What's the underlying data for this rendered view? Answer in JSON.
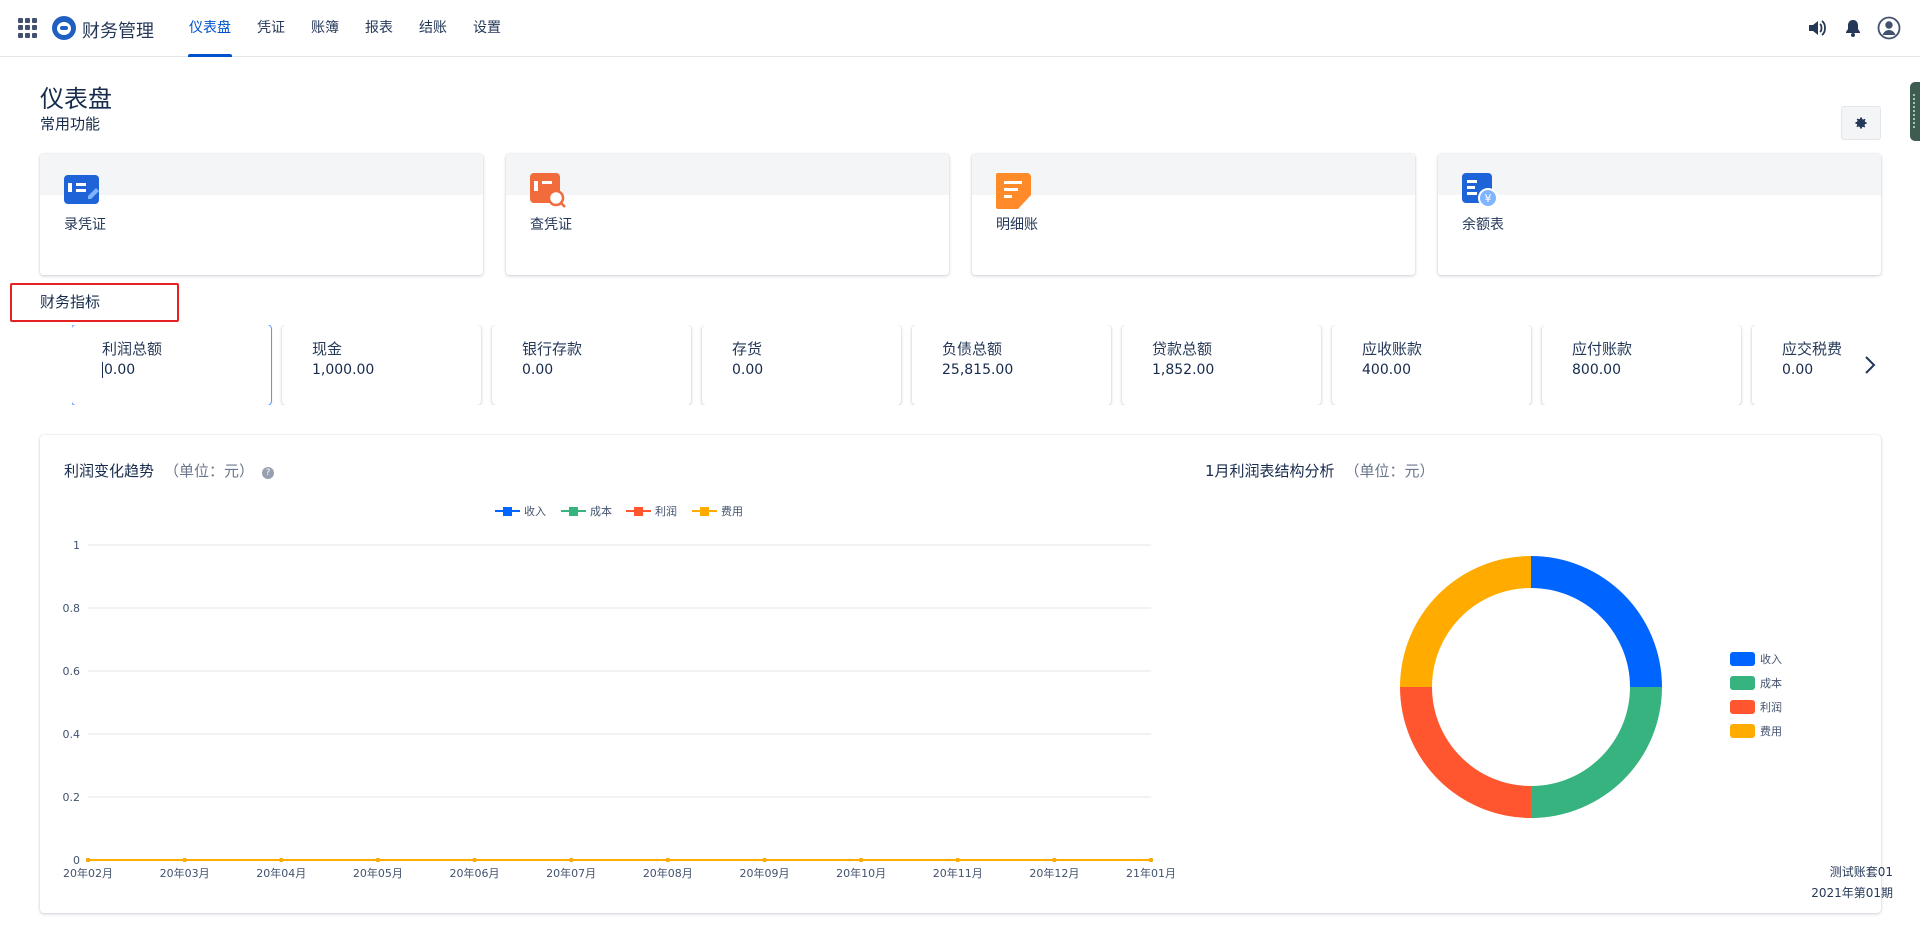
{
  "header": {
    "app_title": "财务管理",
    "nav": [
      {
        "label": "仪表盘",
        "active": true
      },
      {
        "label": "凭证",
        "active": false
      },
      {
        "label": "账簿",
        "active": false
      },
      {
        "label": "报表",
        "active": false
      },
      {
        "label": "结账",
        "active": false
      },
      {
        "label": "设置",
        "active": false
      }
    ],
    "icons": [
      "apps-grid-icon",
      "app-logo",
      "volume-icon",
      "bell-icon",
      "user-avatar-icon"
    ]
  },
  "page": {
    "title": "仪表盘",
    "common_functions_label": "常用功能",
    "financial_indicators_label": "财务指标"
  },
  "quick_links": [
    {
      "label": "录凭证",
      "icon": "record-voucher-icon",
      "color": "#1f63d8"
    },
    {
      "label": "查凭证",
      "icon": "search-voucher-icon",
      "color": "#f26b3a"
    },
    {
      "label": "明细账",
      "icon": "ledger-detail-icon",
      "color": "#ff8a2a"
    },
    {
      "label": "余额表",
      "icon": "balance-sheet-icon",
      "color": "#1f63d8"
    }
  ],
  "metrics": [
    {
      "label": "利润总额",
      "value": "0.00",
      "selected": true
    },
    {
      "label": "现金",
      "value": "1,000.00"
    },
    {
      "label": "银行存款",
      "value": "0.00"
    },
    {
      "label": "存货",
      "value": "0.00"
    },
    {
      "label": "负债总额",
      "value": "25,815.00"
    },
    {
      "label": "贷款总额",
      "value": "1,852.00"
    },
    {
      "label": "应收账款",
      "value": "400.00"
    },
    {
      "label": "应付账款",
      "value": "800.00"
    },
    {
      "label": "应交税费",
      "value": "0.00"
    }
  ],
  "charts": {
    "trend": {
      "title": "利润变化趋势",
      "unit": "（单位：元）"
    },
    "structure": {
      "title": "1月利润表结构分析",
      "unit": "（单位：元）"
    }
  },
  "chart_data": [
    {
      "type": "line",
      "title": "利润变化趋势",
      "subtitle": "（单位：元）",
      "categories": [
        "20年02月",
        "20年03月",
        "20年04月",
        "20年05月",
        "20年06月",
        "20年07月",
        "20年08月",
        "20年09月",
        "20年10月",
        "20年11月",
        "20年12月",
        "21年01月"
      ],
      "series": [
        {
          "name": "收入",
          "values": [
            0,
            0,
            0,
            0,
            0,
            0,
            0,
            0,
            0,
            0,
            0,
            0
          ],
          "color": "#0065ff"
        },
        {
          "name": "成本",
          "values": [
            0,
            0,
            0,
            0,
            0,
            0,
            0,
            0,
            0,
            0,
            0,
            0
          ],
          "color": "#36b37e"
        },
        {
          "name": "利润",
          "values": [
            0,
            0,
            0,
            0,
            0,
            0,
            0,
            0,
            0,
            0,
            0,
            0
          ],
          "color": "#ff5630"
        },
        {
          "name": "费用",
          "values": [
            0,
            0,
            0,
            0,
            0,
            0,
            0,
            0,
            0,
            0,
            0,
            0
          ],
          "color": "#ffab00"
        }
      ],
      "yticks": [
        "0",
        "0.2",
        "0.4",
        "0.6",
        "0.8",
        "1"
      ],
      "ylim": [
        0,
        1
      ],
      "legend": "top-center",
      "grid": true
    },
    {
      "type": "pie",
      "title": "1月利润表结构分析",
      "subtitle": "（单位：元）",
      "slices": [
        {
          "name": "收入",
          "value": 1,
          "color": "#0065ff"
        },
        {
          "name": "成本",
          "value": 1,
          "color": "#36b37e"
        },
        {
          "name": "利润",
          "value": 1,
          "color": "#ff5630"
        },
        {
          "name": "费用",
          "value": 1,
          "color": "#ffab00"
        }
      ],
      "legend": "right"
    }
  ],
  "footer": {
    "account": "测试账套01",
    "period": "2021年第01期"
  }
}
